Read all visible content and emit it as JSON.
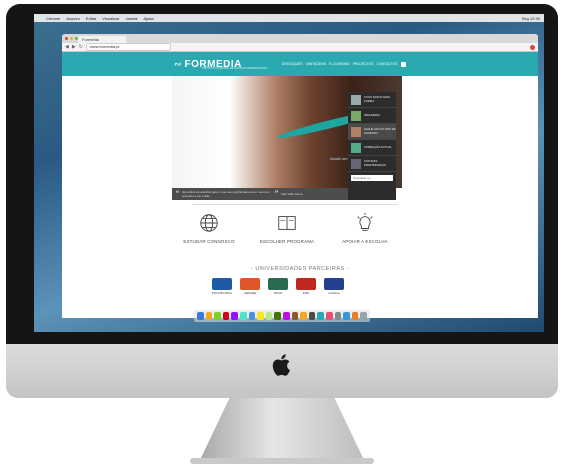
{
  "os": {
    "menubar": {
      "items": [
        "Chrome",
        "Arquivo",
        "Editar",
        "Visualizar",
        "Janela",
        "Ajuda"
      ],
      "clock": "Seg 12:30"
    },
    "dock_icons": [
      "#3a7bd5",
      "#f5a623",
      "#7ed321",
      "#d0021b",
      "#9013fe",
      "#50e3c2",
      "#4a90e2",
      "#f8e71c",
      "#b8e986",
      "#417505",
      "#bd10e0",
      "#8b572a",
      "#f5a623",
      "#4a4a4a",
      "#2ba9b1",
      "#e94e77",
      "#7f8c8d",
      "#3498db",
      "#e67e22",
      "#95a5a6"
    ]
  },
  "browser": {
    "tab_title": "Formedia",
    "url": "www.formedia.pt"
  },
  "site": {
    "brand": "FORMEDIA",
    "tagline": "INSTITUTO EUROPEU DE ESTUDOS EMPRESARIAIS",
    "nav": [
      "DESTAQUES",
      "VANTAGENS",
      "E-LEARNING",
      "PROJECTOS",
      "CONTACTOS"
    ],
    "hero_caption": "Avalie um Futuro de Sucesso",
    "quote": {
      "text": "Há muitos de estudos para o meu ano problemas para o meu sou entender e ser então",
      "author": "Inês Vilão Aluno"
    },
    "side_items": [
      {
        "label": "TOLIS NATA E MAIS FORMA"
      },
      {
        "label": "JEMI EMIDA"
      },
      {
        "label": "AVALIE UM FUTURO DE SUCESSO"
      },
      {
        "label": "FORMAÇÃO ACTUAL"
      },
      {
        "label": "FUTURAS PROFISSIONAIS"
      }
    ],
    "side_search_placeholder": "Pesquisar no",
    "actions": [
      {
        "label": "ESTUDAR CONNOSCO",
        "icon": "globe-icon"
      },
      {
        "label": "ESCOLHER PROGRAMA",
        "icon": "book-icon"
      },
      {
        "label": "APOIAR A ESCOLHA",
        "icon": "lightbulb-icon"
      }
    ],
    "partners_title": "- UNIVERSIDADES PARCEIRAS -",
    "partners": [
      {
        "name": "POLITÉCNICA",
        "color": "#1f5aa6"
      },
      {
        "name": "CEPADE",
        "color": "#e0562a"
      },
      {
        "name": "NOVA",
        "color": "#2a6a4f"
      },
      {
        "name": "FMH",
        "color": "#c0271f"
      },
      {
        "name": "ULisboa",
        "color": "#24408e"
      }
    ]
  }
}
